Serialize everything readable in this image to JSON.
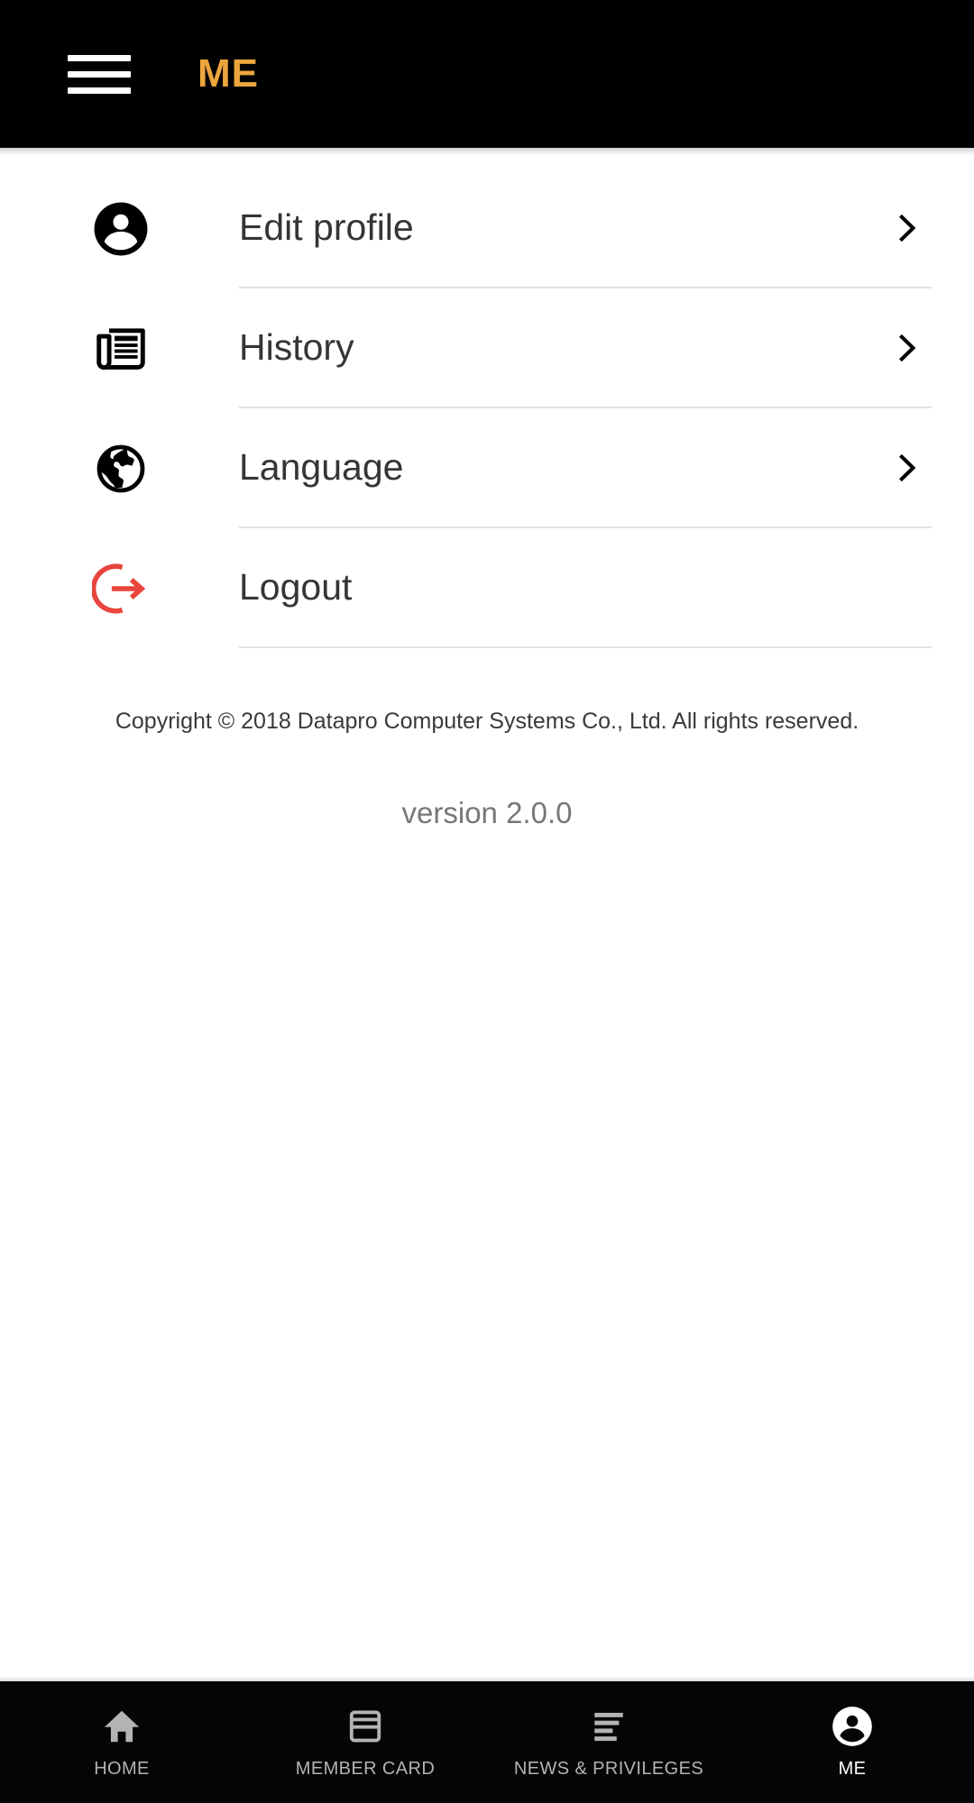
{
  "appbar": {
    "menu_icon": "hamburger-menu-icon",
    "title": "ME"
  },
  "menu": {
    "items": [
      {
        "label": "Edit profile",
        "icon": "account-circle-icon",
        "icon_color": "#000000",
        "has_chevron": true
      },
      {
        "label": "History",
        "icon": "newspaper-icon",
        "icon_color": "#000000",
        "has_chevron": true
      },
      {
        "label": "Language",
        "icon": "globe-icon",
        "icon_color": "#000000",
        "has_chevron": true
      },
      {
        "label": "Logout",
        "icon": "logout-arrow-icon",
        "icon_color": "#e8453c",
        "has_chevron": false
      }
    ]
  },
  "footer": {
    "copyright": "Copyright © 2018 Datapro Computer Systems Co., Ltd. All rights reserved.",
    "version": "version 2.0.0"
  },
  "bottom_nav": {
    "items": [
      {
        "label": "HOME",
        "icon": "home-icon",
        "active": false
      },
      {
        "label": "MEMBER CARD",
        "icon": "credit-card-icon",
        "active": false
      },
      {
        "label": "NEWS & PRIVILEGES",
        "icon": "align-left-lines-icon",
        "active": false
      },
      {
        "label": "ME",
        "icon": "account-circle-icon",
        "active": true
      }
    ]
  },
  "colors": {
    "appbar_background": "#000000",
    "appbar_title": "#eda53d",
    "page_background": "#ffffff",
    "divider": "#e2e2e2",
    "label_text": "#353535",
    "logout_accent": "#e8453c",
    "nav_inactive": "#b3b3b3",
    "nav_active": "#ffffff",
    "nav_background": "#050505"
  }
}
